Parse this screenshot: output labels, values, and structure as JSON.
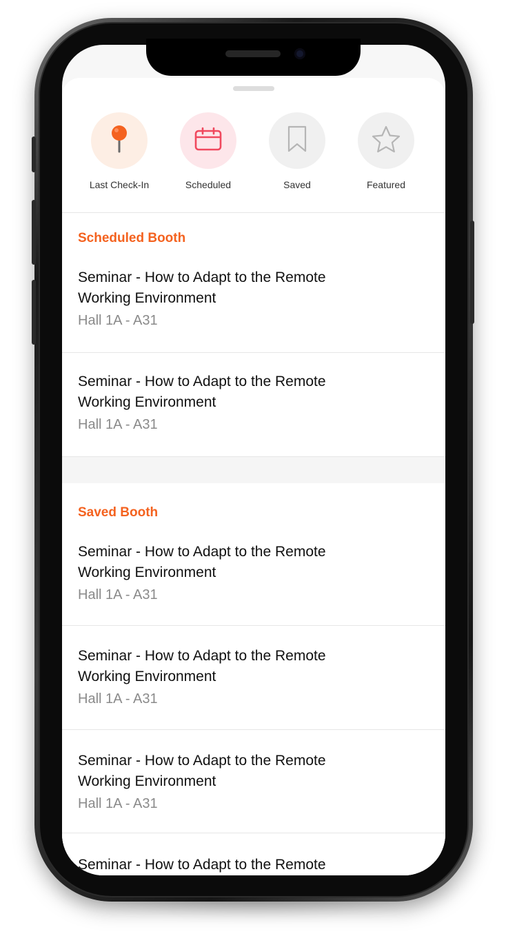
{
  "quick_actions": [
    {
      "label": "Last Check-In",
      "icon": "pin-icon",
      "bg": "#fdeee4",
      "color": "#f4621f"
    },
    {
      "label": "Scheduled",
      "icon": "calendar-icon",
      "bg": "#fde6ea",
      "color": "#f0495e"
    },
    {
      "label": "Saved",
      "icon": "bookmark-icon",
      "bg": "#f0f0f0",
      "color": "#b5b5b5"
    },
    {
      "label": "Featured",
      "icon": "star-icon",
      "bg": "#f0f0f0",
      "color": "#b5b5b5"
    }
  ],
  "scheduled": {
    "title": "Scheduled Booth",
    "items": [
      {
        "title": "Seminar - How to Adapt to the Remote Working Environment",
        "location": "Hall 1A - A31"
      },
      {
        "title": "Seminar - How to Adapt to the Remote Working Environment",
        "location": "Hall 1A - A31"
      }
    ]
  },
  "saved": {
    "title": "Saved Booth",
    "items": [
      {
        "title": "Seminar - How to Adapt to the Remote Working Environment",
        "location": "Hall 1A - A31"
      },
      {
        "title": "Seminar - How to Adapt to the Remote Working Environment",
        "location": "Hall 1A - A31"
      },
      {
        "title": "Seminar - How to Adapt to the Remote Working Environment",
        "location": "Hall 1A - A31"
      },
      {
        "title": "Seminar - How to Adapt to the Remote",
        "location": ""
      }
    ]
  },
  "accent_color": "#f4621f"
}
